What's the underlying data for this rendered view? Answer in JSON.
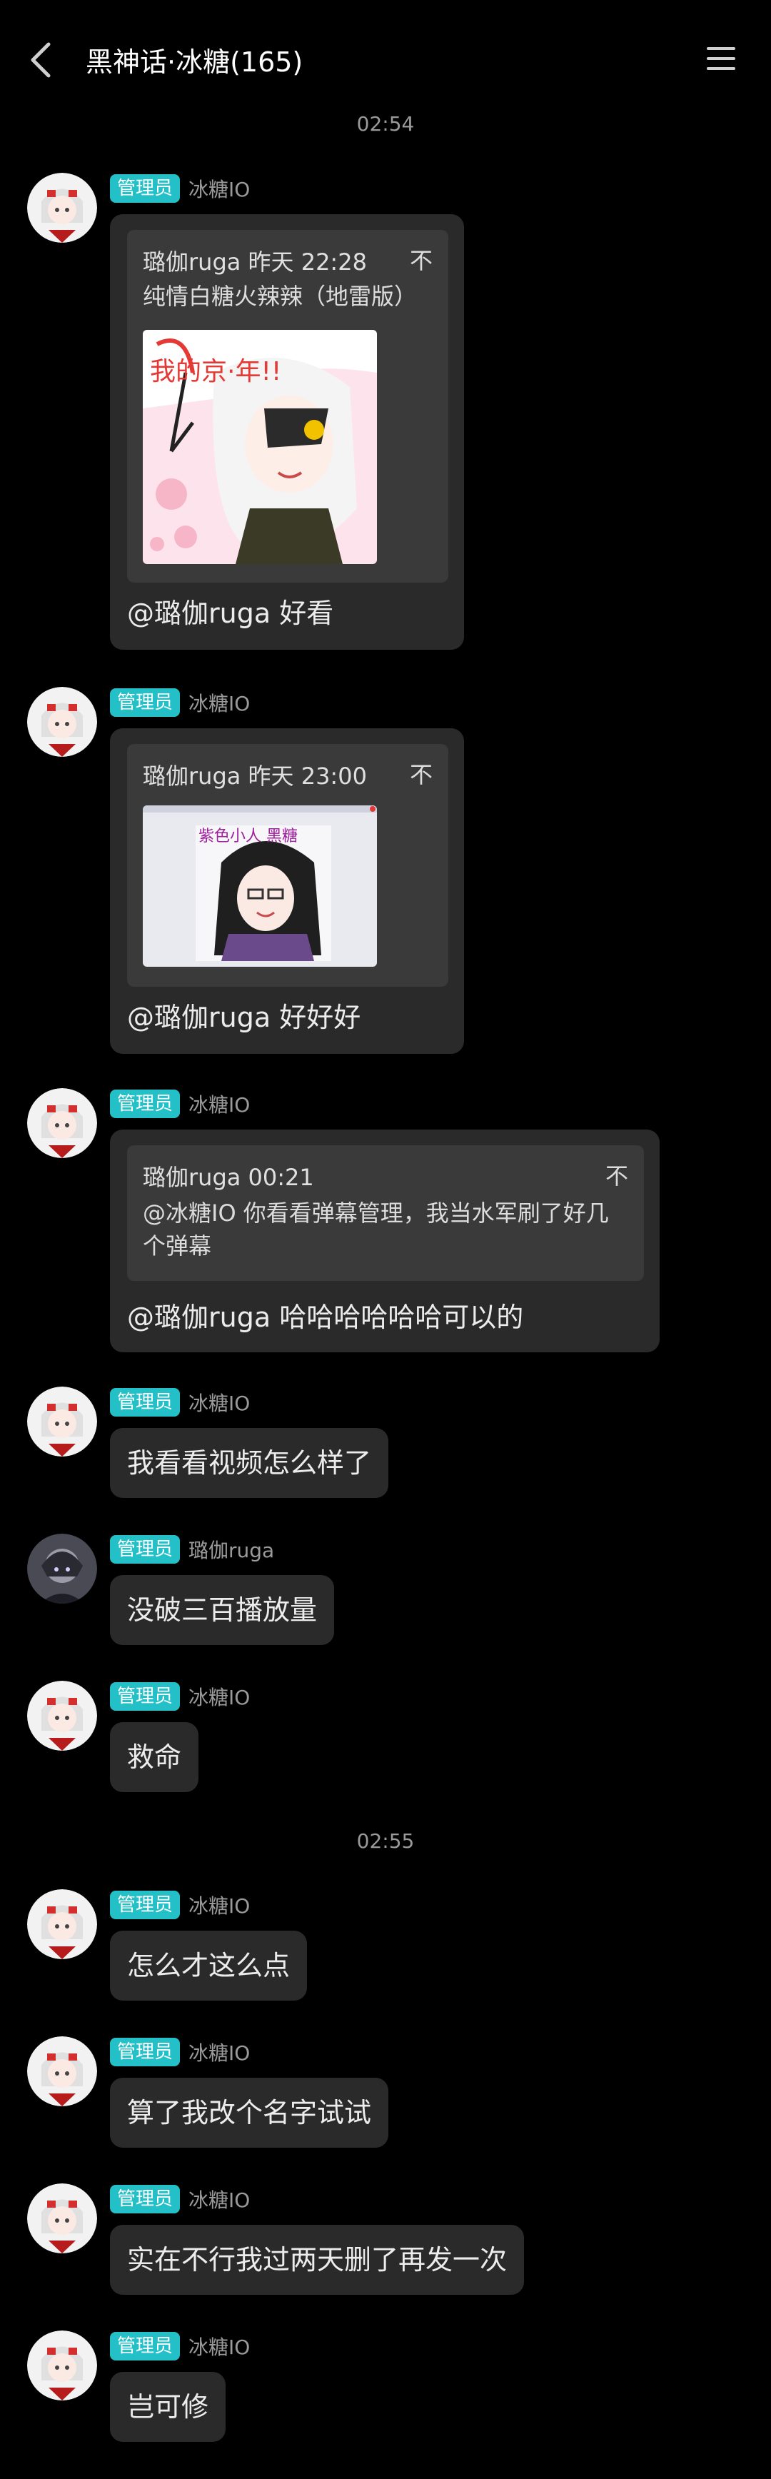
{
  "header": {
    "title": "黑神话·冰糖(165)"
  },
  "times": [
    "02:54",
    "02:55"
  ],
  "badge": "管理员",
  "messages": [
    {
      "sender": "冰糖IO",
      "quote_head": "璐伽ruga 昨天 22:28",
      "quote_text": "纯情白糖火辣辣（地雷版）",
      "image_text": "我的京·年!!",
      "reply": "@璐伽ruga 好看"
    },
    {
      "sender": "冰糖IO",
      "quote_head": "璐伽ruga 昨天 23:00",
      "image_text": "紫色小人 黑糖",
      "reply": "@璐伽ruga 好好好"
    },
    {
      "sender": "冰糖IO",
      "quote_head": "璐伽ruga 00:21",
      "quote_text": "@冰糖IO 你看看弹幕管理，我当水军刷了好几个弹幕",
      "reply": "@璐伽ruga 哈哈哈哈哈哈可以的"
    },
    {
      "sender": "冰糖IO",
      "text": "我看看视频怎么样了"
    },
    {
      "sender": "璐伽ruga",
      "text": "没破三百播放量"
    },
    {
      "sender": "冰糖IO",
      "text": "救命"
    },
    {
      "sender": "冰糖IO",
      "text": "怎么才这么点"
    },
    {
      "sender": "冰糖IO",
      "text": "算了我改个名字试试"
    },
    {
      "sender": "冰糖IO",
      "text": "实在不行我过两天删了再发一次"
    },
    {
      "sender": "冰糖IO",
      "text": "岂可修"
    }
  ],
  "icons": {
    "back": "chevron-left-icon",
    "menu": "hamburger-menu-icon",
    "pin": "pin-icon"
  },
  "colors": {
    "badge": "#23c0c8",
    "bubble": "#2a2a2a",
    "quote": "#3a3a3a",
    "background": "#000000"
  }
}
